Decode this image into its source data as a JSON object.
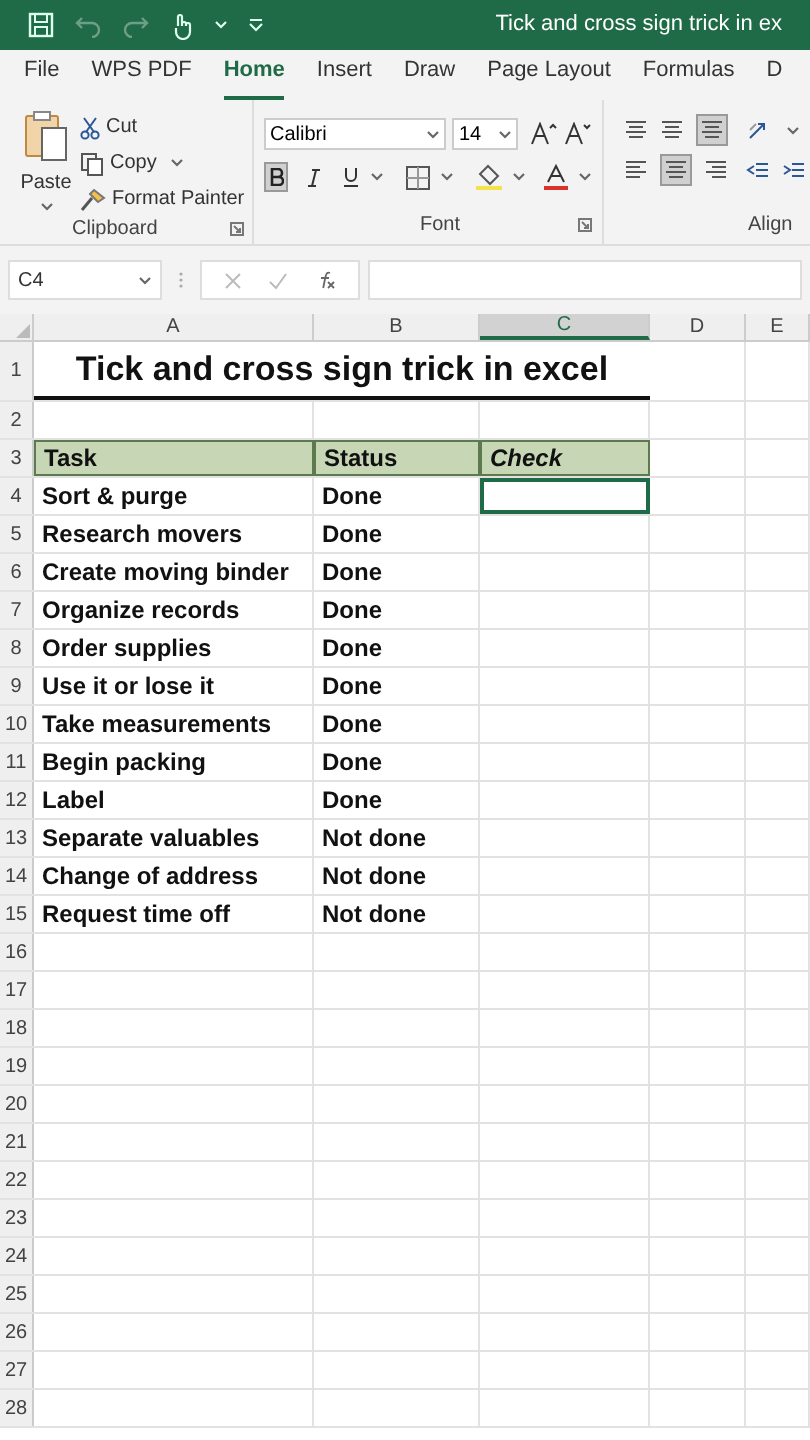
{
  "title_bar": {
    "title": "Tick and cross sign trick in ex"
  },
  "tabs": [
    {
      "label": "File",
      "selected": false
    },
    {
      "label": "WPS PDF",
      "selected": false
    },
    {
      "label": "Home",
      "selected": true
    },
    {
      "label": "Insert",
      "selected": false
    },
    {
      "label": "Draw",
      "selected": false
    },
    {
      "label": "Page Layout",
      "selected": false
    },
    {
      "label": "Formulas",
      "selected": false
    },
    {
      "label": "D",
      "selected": false
    }
  ],
  "ribbon": {
    "clipboard": {
      "paste": "Paste",
      "cut": "Cut",
      "copy": "Copy",
      "format_painter": "Format Painter",
      "label": "Clipboard"
    },
    "font": {
      "font_name": "Calibri",
      "font_size": "14",
      "bold_selected": true,
      "label": "Font"
    },
    "alignment": {
      "label": "Align"
    }
  },
  "formula_bar": {
    "name_box": "C4"
  },
  "columns": [
    {
      "label": "A",
      "selected": false
    },
    {
      "label": "B",
      "selected": false
    },
    {
      "label": "C",
      "selected": true
    },
    {
      "label": "D",
      "selected": false
    },
    {
      "label": "E",
      "selected": false
    }
  ],
  "rows": [
    {
      "number": "1",
      "kind": "title",
      "cells": [
        "Tick and cross sign trick in excel"
      ]
    },
    {
      "number": "2",
      "kind": "empty",
      "cells": []
    },
    {
      "number": "3",
      "kind": "header",
      "cells": [
        "Task",
        "Status",
        "Check"
      ]
    },
    {
      "number": "4",
      "kind": "data",
      "cells": [
        "Sort & purge",
        "Done"
      ],
      "selected_check": true
    },
    {
      "number": "5",
      "kind": "data",
      "cells": [
        "Research movers",
        "Done"
      ],
      "selected_check": false
    },
    {
      "number": "6",
      "kind": "data",
      "cells": [
        "Create moving binder",
        "Done"
      ],
      "selected_check": false
    },
    {
      "number": "7",
      "kind": "data",
      "cells": [
        "Organize records",
        "Done"
      ],
      "selected_check": false
    },
    {
      "number": "8",
      "kind": "data",
      "cells": [
        "Order supplies",
        "Done"
      ],
      "selected_check": false
    },
    {
      "number": "9",
      "kind": "data",
      "cells": [
        "Use it or lose it",
        "Done"
      ],
      "selected_check": false
    },
    {
      "number": "10",
      "kind": "data",
      "cells": [
        "Take measurements",
        "Done"
      ],
      "selected_check": false
    },
    {
      "number": "11",
      "kind": "data",
      "cells": [
        "Begin packing",
        "Done"
      ],
      "selected_check": false
    },
    {
      "number": "12",
      "kind": "data",
      "cells": [
        "Label",
        "Done"
      ],
      "selected_check": false
    },
    {
      "number": "13",
      "kind": "data",
      "cells": [
        "Separate valuables",
        "Not done"
      ],
      "selected_check": false
    },
    {
      "number": "14",
      "kind": "data",
      "cells": [
        "Change of address",
        "Not done"
      ],
      "selected_check": false
    },
    {
      "number": "15",
      "kind": "data",
      "cells": [
        "Request time off",
        "Not done"
      ],
      "selected_check": false
    },
    {
      "number": "16",
      "kind": "empty",
      "cells": []
    },
    {
      "number": "17",
      "kind": "empty",
      "cells": []
    },
    {
      "number": "18",
      "kind": "empty",
      "cells": []
    },
    {
      "number": "19",
      "kind": "empty",
      "cells": []
    },
    {
      "number": "20",
      "kind": "empty",
      "cells": []
    },
    {
      "number": "21",
      "kind": "empty",
      "cells": []
    },
    {
      "number": "22",
      "kind": "empty",
      "cells": []
    },
    {
      "number": "23",
      "kind": "empty",
      "cells": []
    },
    {
      "number": "24",
      "kind": "empty",
      "cells": []
    },
    {
      "number": "25",
      "kind": "empty",
      "cells": []
    },
    {
      "number": "26",
      "kind": "empty",
      "cells": []
    },
    {
      "number": "27",
      "kind": "empty",
      "cells": []
    },
    {
      "number": "28",
      "kind": "empty",
      "cells": []
    }
  ]
}
